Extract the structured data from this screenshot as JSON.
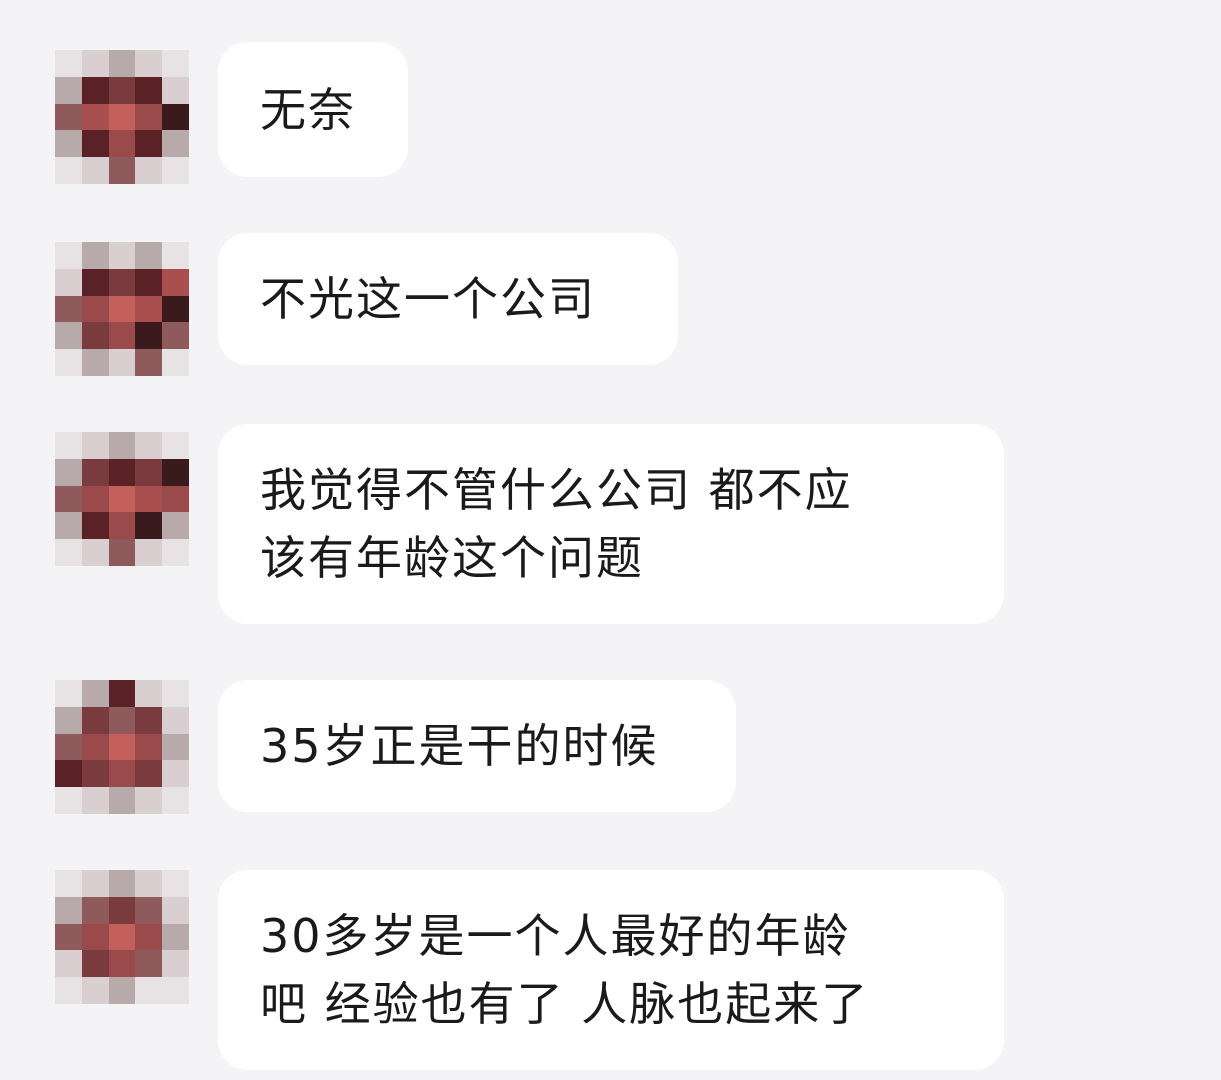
{
  "chat": {
    "messages": [
      {
        "text": "无奈"
      },
      {
        "text": "不光这一个公司"
      },
      {
        "text": "我觉得不管什么公司 都不应\n该有年龄这个问题"
      },
      {
        "text": "35岁正是干的时候"
      },
      {
        "text": "30多岁是一个人最好的年龄\n吧 经验也有了 人脉也起来了"
      }
    ]
  },
  "colors": {
    "background": "#f4f4f6",
    "bubble": "#ffffff",
    "text": "#1a1a1a"
  }
}
